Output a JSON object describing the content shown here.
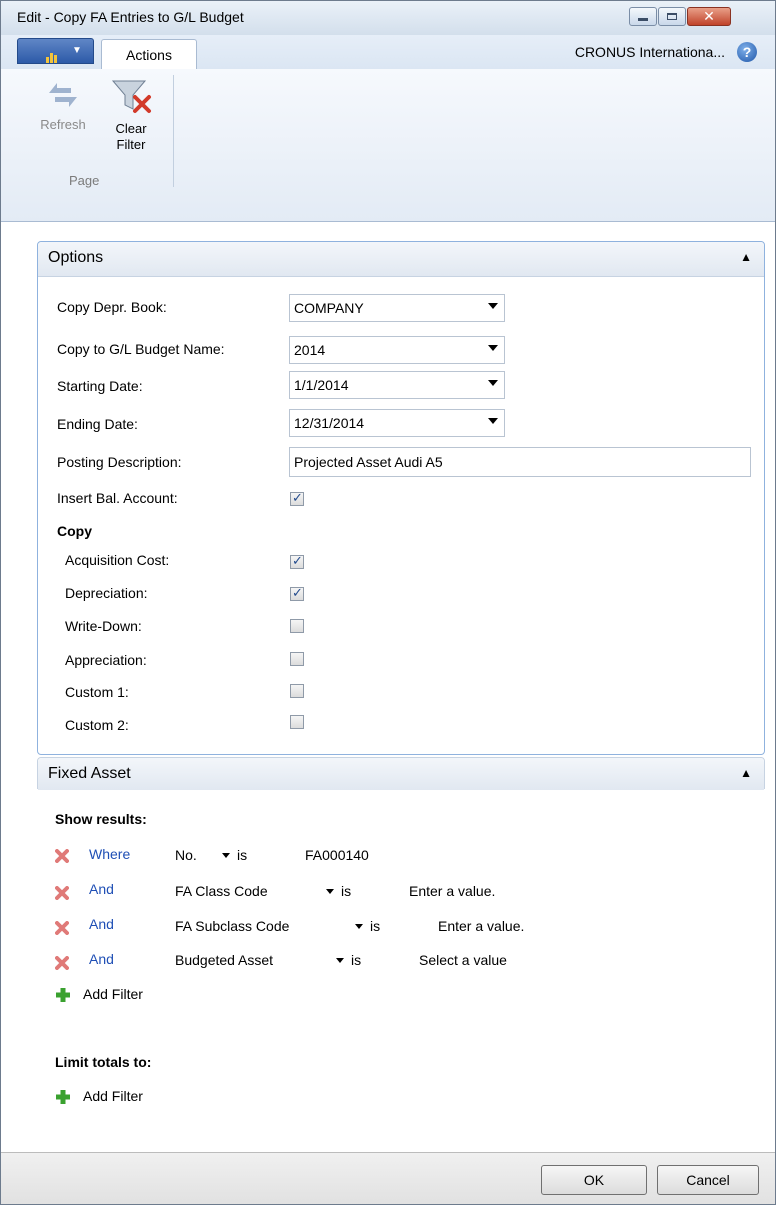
{
  "window": {
    "title": "Edit - Copy FA Entries to G/L Budget",
    "company": "CRONUS Internationa...",
    "help_glyph": "?"
  },
  "ribbon": {
    "tabs": [
      {
        "label": "Actions"
      }
    ],
    "buttons": {
      "refresh": "Refresh",
      "clear_filter_line1": "Clear",
      "clear_filter_line2": "Filter"
    },
    "group_label": "Page"
  },
  "options": {
    "title": "Options",
    "fields": {
      "copy_depr_book": {
        "label": "Copy Depr. Book:",
        "value": "COMPANY"
      },
      "copy_to_budget": {
        "label": "Copy to G/L Budget Name:",
        "value": "2014"
      },
      "starting_date": {
        "label": "Starting Date:",
        "value": "1/1/2014"
      },
      "ending_date": {
        "label": "Ending Date:",
        "value": "12/31/2014"
      },
      "posting_description": {
        "label": "Posting Description:",
        "value": "Projected Asset Audi A5"
      },
      "insert_bal_account": {
        "label": "Insert Bal. Account:",
        "checked": true
      }
    },
    "copy_heading": "Copy",
    "copy": [
      {
        "label": "Acquisition Cost:",
        "checked": true
      },
      {
        "label": "Depreciation:",
        "checked": true
      },
      {
        "label": "Write-Down:",
        "checked": false
      },
      {
        "label": "Appreciation:",
        "checked": false
      },
      {
        "label": "Custom 1:",
        "checked": false
      },
      {
        "label": "Custom 2:",
        "checked": false
      }
    ]
  },
  "fixed_asset": {
    "title": "Fixed Asset",
    "show_results": "Show results:",
    "filters": [
      {
        "conj": "Where",
        "field": "No.",
        "op": "is",
        "value": "FA000140"
      },
      {
        "conj": "And",
        "field": "FA Class Code",
        "op": "is",
        "value": "Enter a value."
      },
      {
        "conj": "And",
        "field": "FA Subclass Code",
        "op": "is",
        "value": "Enter a value."
      },
      {
        "conj": "And",
        "field": "Budgeted Asset",
        "op": "is",
        "value": "Select a value"
      }
    ],
    "add_filter": "Add Filter",
    "limit_totals": "Limit totals to:",
    "add_filter_2": "Add Filter"
  },
  "footer": {
    "ok": "OK",
    "cancel": "Cancel"
  }
}
